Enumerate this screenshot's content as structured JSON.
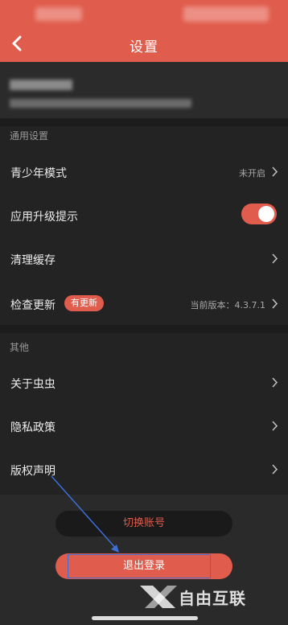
{
  "header": {
    "title": "设置"
  },
  "sections": {
    "general_label": "通用设置",
    "other_label": "其他"
  },
  "rows": {
    "youth_mode": {
      "label": "青少年模式",
      "value": "未开启"
    },
    "upgrade_prompt": {
      "label": "应用升级提示",
      "toggle_on": true
    },
    "clear_cache": {
      "label": "清理缓存"
    },
    "check_update": {
      "label": "检查更新",
      "badge": "有更新",
      "value": "当前版本：4.3.7.1"
    },
    "about": {
      "label": "关于虫虫"
    },
    "privacy": {
      "label": "隐私政策"
    },
    "copyright": {
      "label": "版权声明"
    }
  },
  "buttons": {
    "switch_account": "切换账号",
    "logout": "退出登录"
  },
  "watermark": {
    "text": "自由互联"
  },
  "colors": {
    "accent": "#e05c4c",
    "background": "#232323",
    "annotation": "#3f6fd6"
  },
  "icons": [
    "back-arrow-icon",
    "chevron-right-icon",
    "toggle-switch",
    "watermark-x-logo-icon"
  ]
}
